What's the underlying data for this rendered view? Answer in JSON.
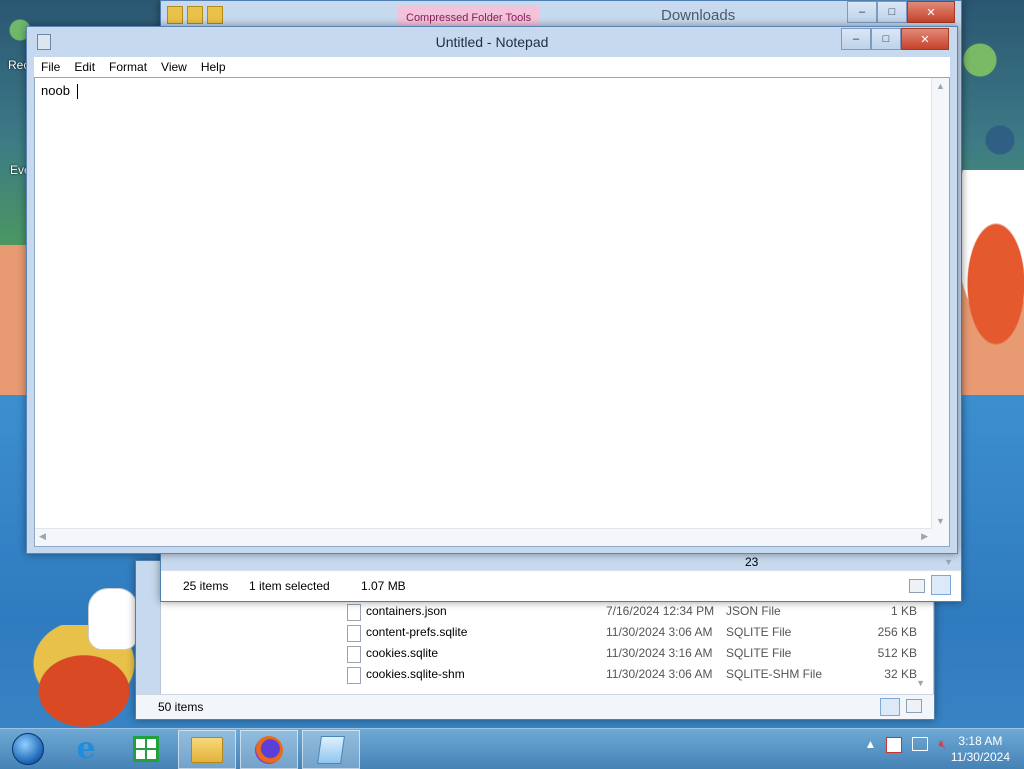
{
  "notepad": {
    "title": "Untitled - Notepad",
    "menu": [
      "File",
      "Edit",
      "Format",
      "View",
      "Help"
    ],
    "content": "noob",
    "caption_buttons": {
      "minimize": "‒",
      "maximize": "□",
      "close": "✕"
    }
  },
  "explorer_front": {
    "title": "Downloads",
    "context_tab": "Compressed Folder Tools",
    "status": {
      "items": "25 items",
      "selection": "1 item selected",
      "size": "1.07 MB"
    },
    "partial_value": "23",
    "caption_buttons": {
      "minimize": "‒",
      "maximize": "□",
      "close": "✕"
    }
  },
  "explorer_back": {
    "status": {
      "items": "50 items"
    },
    "files": [
      {
        "name": "containers.json",
        "date": "7/16/2024 12:34 PM",
        "type": "JSON File",
        "size": "1 KB"
      },
      {
        "name": "content-prefs.sqlite",
        "date": "11/30/2024 3:06 AM",
        "type": "SQLITE File",
        "size": "256 KB"
      },
      {
        "name": "cookies.sqlite",
        "date": "11/30/2024 3:16 AM",
        "type": "SQLITE File",
        "size": "512 KB"
      },
      {
        "name": "cookies.sqlite-shm",
        "date": "11/30/2024 3:06 AM",
        "type": "SQLITE-SHM File",
        "size": "32 KB"
      }
    ]
  },
  "desktop": {
    "icon_labels": [
      "Rec",
      "Eve"
    ]
  },
  "taskbar": {
    "items": [
      "start-button",
      "internet-explorer",
      "windows-store",
      "file-explorer",
      "firefox",
      "notepad"
    ],
    "active_item": "notepad",
    "clock": {
      "time": "3:18 AM",
      "date": "11/30/2024"
    },
    "tray_icons": [
      "show-hidden-icons",
      "action-center-icon",
      "network-icon",
      "volume-muted-icon"
    ]
  },
  "colors": {
    "window_frame": "#c6d9ee",
    "close_button": "#c7432c",
    "context_tab": "#f3c3dc"
  }
}
